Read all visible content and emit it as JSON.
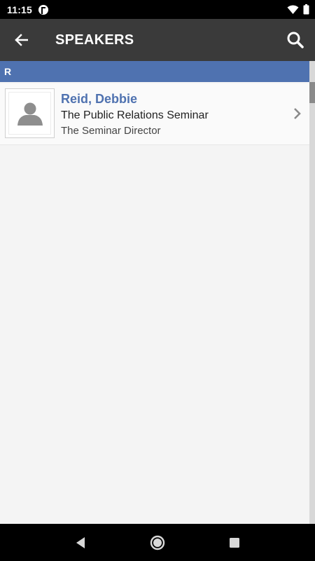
{
  "status_bar": {
    "time": "11:15"
  },
  "app_bar": {
    "title": "SPEAKERS"
  },
  "section": {
    "letter": "R"
  },
  "speakers": [
    {
      "name": "Reid, Debbie",
      "organization": "The Public Relations Seminar",
      "title": "The Seminar Director"
    }
  ],
  "colors": {
    "accent": "#4f72b0",
    "app_bar": "#3a3a3a",
    "background": "#f4f4f4"
  }
}
